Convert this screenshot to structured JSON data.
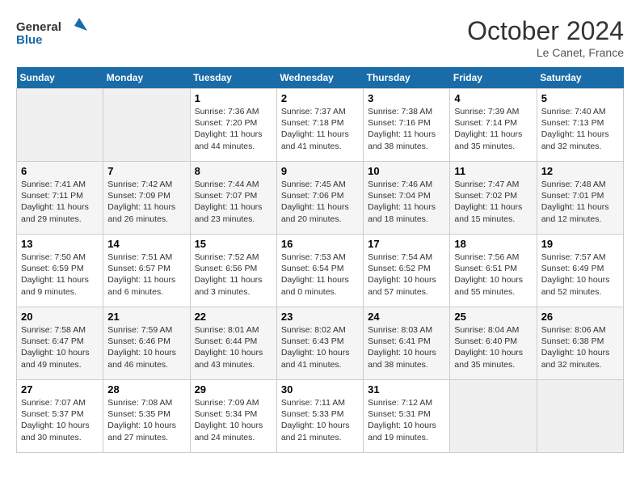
{
  "header": {
    "logo_line1": "General",
    "logo_line2": "Blue",
    "title": "October 2024",
    "subtitle": "Le Canet, France"
  },
  "days_of_week": [
    "Sunday",
    "Monday",
    "Tuesday",
    "Wednesday",
    "Thursday",
    "Friday",
    "Saturday"
  ],
  "weeks": [
    [
      {
        "day": "",
        "info": ""
      },
      {
        "day": "",
        "info": ""
      },
      {
        "day": "1",
        "info": "Sunrise: 7:36 AM\nSunset: 7:20 PM\nDaylight: 11 hours\nand 44 minutes."
      },
      {
        "day": "2",
        "info": "Sunrise: 7:37 AM\nSunset: 7:18 PM\nDaylight: 11 hours\nand 41 minutes."
      },
      {
        "day": "3",
        "info": "Sunrise: 7:38 AM\nSunset: 7:16 PM\nDaylight: 11 hours\nand 38 minutes."
      },
      {
        "day": "4",
        "info": "Sunrise: 7:39 AM\nSunset: 7:14 PM\nDaylight: 11 hours\nand 35 minutes."
      },
      {
        "day": "5",
        "info": "Sunrise: 7:40 AM\nSunset: 7:13 PM\nDaylight: 11 hours\nand 32 minutes."
      }
    ],
    [
      {
        "day": "6",
        "info": "Sunrise: 7:41 AM\nSunset: 7:11 PM\nDaylight: 11 hours\nand 29 minutes."
      },
      {
        "day": "7",
        "info": "Sunrise: 7:42 AM\nSunset: 7:09 PM\nDaylight: 11 hours\nand 26 minutes."
      },
      {
        "day": "8",
        "info": "Sunrise: 7:44 AM\nSunset: 7:07 PM\nDaylight: 11 hours\nand 23 minutes."
      },
      {
        "day": "9",
        "info": "Sunrise: 7:45 AM\nSunset: 7:06 PM\nDaylight: 11 hours\nand 20 minutes."
      },
      {
        "day": "10",
        "info": "Sunrise: 7:46 AM\nSunset: 7:04 PM\nDaylight: 11 hours\nand 18 minutes."
      },
      {
        "day": "11",
        "info": "Sunrise: 7:47 AM\nSunset: 7:02 PM\nDaylight: 11 hours\nand 15 minutes."
      },
      {
        "day": "12",
        "info": "Sunrise: 7:48 AM\nSunset: 7:01 PM\nDaylight: 11 hours\nand 12 minutes."
      }
    ],
    [
      {
        "day": "13",
        "info": "Sunrise: 7:50 AM\nSunset: 6:59 PM\nDaylight: 11 hours\nand 9 minutes."
      },
      {
        "day": "14",
        "info": "Sunrise: 7:51 AM\nSunset: 6:57 PM\nDaylight: 11 hours\nand 6 minutes."
      },
      {
        "day": "15",
        "info": "Sunrise: 7:52 AM\nSunset: 6:56 PM\nDaylight: 11 hours\nand 3 minutes."
      },
      {
        "day": "16",
        "info": "Sunrise: 7:53 AM\nSunset: 6:54 PM\nDaylight: 11 hours\nand 0 minutes."
      },
      {
        "day": "17",
        "info": "Sunrise: 7:54 AM\nSunset: 6:52 PM\nDaylight: 10 hours\nand 57 minutes."
      },
      {
        "day": "18",
        "info": "Sunrise: 7:56 AM\nSunset: 6:51 PM\nDaylight: 10 hours\nand 55 minutes."
      },
      {
        "day": "19",
        "info": "Sunrise: 7:57 AM\nSunset: 6:49 PM\nDaylight: 10 hours\nand 52 minutes."
      }
    ],
    [
      {
        "day": "20",
        "info": "Sunrise: 7:58 AM\nSunset: 6:47 PM\nDaylight: 10 hours\nand 49 minutes."
      },
      {
        "day": "21",
        "info": "Sunrise: 7:59 AM\nSunset: 6:46 PM\nDaylight: 10 hours\nand 46 minutes."
      },
      {
        "day": "22",
        "info": "Sunrise: 8:01 AM\nSunset: 6:44 PM\nDaylight: 10 hours\nand 43 minutes."
      },
      {
        "day": "23",
        "info": "Sunrise: 8:02 AM\nSunset: 6:43 PM\nDaylight: 10 hours\nand 41 minutes."
      },
      {
        "day": "24",
        "info": "Sunrise: 8:03 AM\nSunset: 6:41 PM\nDaylight: 10 hours\nand 38 minutes."
      },
      {
        "day": "25",
        "info": "Sunrise: 8:04 AM\nSunset: 6:40 PM\nDaylight: 10 hours\nand 35 minutes."
      },
      {
        "day": "26",
        "info": "Sunrise: 8:06 AM\nSunset: 6:38 PM\nDaylight: 10 hours\nand 32 minutes."
      }
    ],
    [
      {
        "day": "27",
        "info": "Sunrise: 7:07 AM\nSunset: 5:37 PM\nDaylight: 10 hours\nand 30 minutes."
      },
      {
        "day": "28",
        "info": "Sunrise: 7:08 AM\nSunset: 5:35 PM\nDaylight: 10 hours\nand 27 minutes."
      },
      {
        "day": "29",
        "info": "Sunrise: 7:09 AM\nSunset: 5:34 PM\nDaylight: 10 hours\nand 24 minutes."
      },
      {
        "day": "30",
        "info": "Sunrise: 7:11 AM\nSunset: 5:33 PM\nDaylight: 10 hours\nand 21 minutes."
      },
      {
        "day": "31",
        "info": "Sunrise: 7:12 AM\nSunset: 5:31 PM\nDaylight: 10 hours\nand 19 minutes."
      },
      {
        "day": "",
        "info": ""
      },
      {
        "day": "",
        "info": ""
      }
    ]
  ]
}
